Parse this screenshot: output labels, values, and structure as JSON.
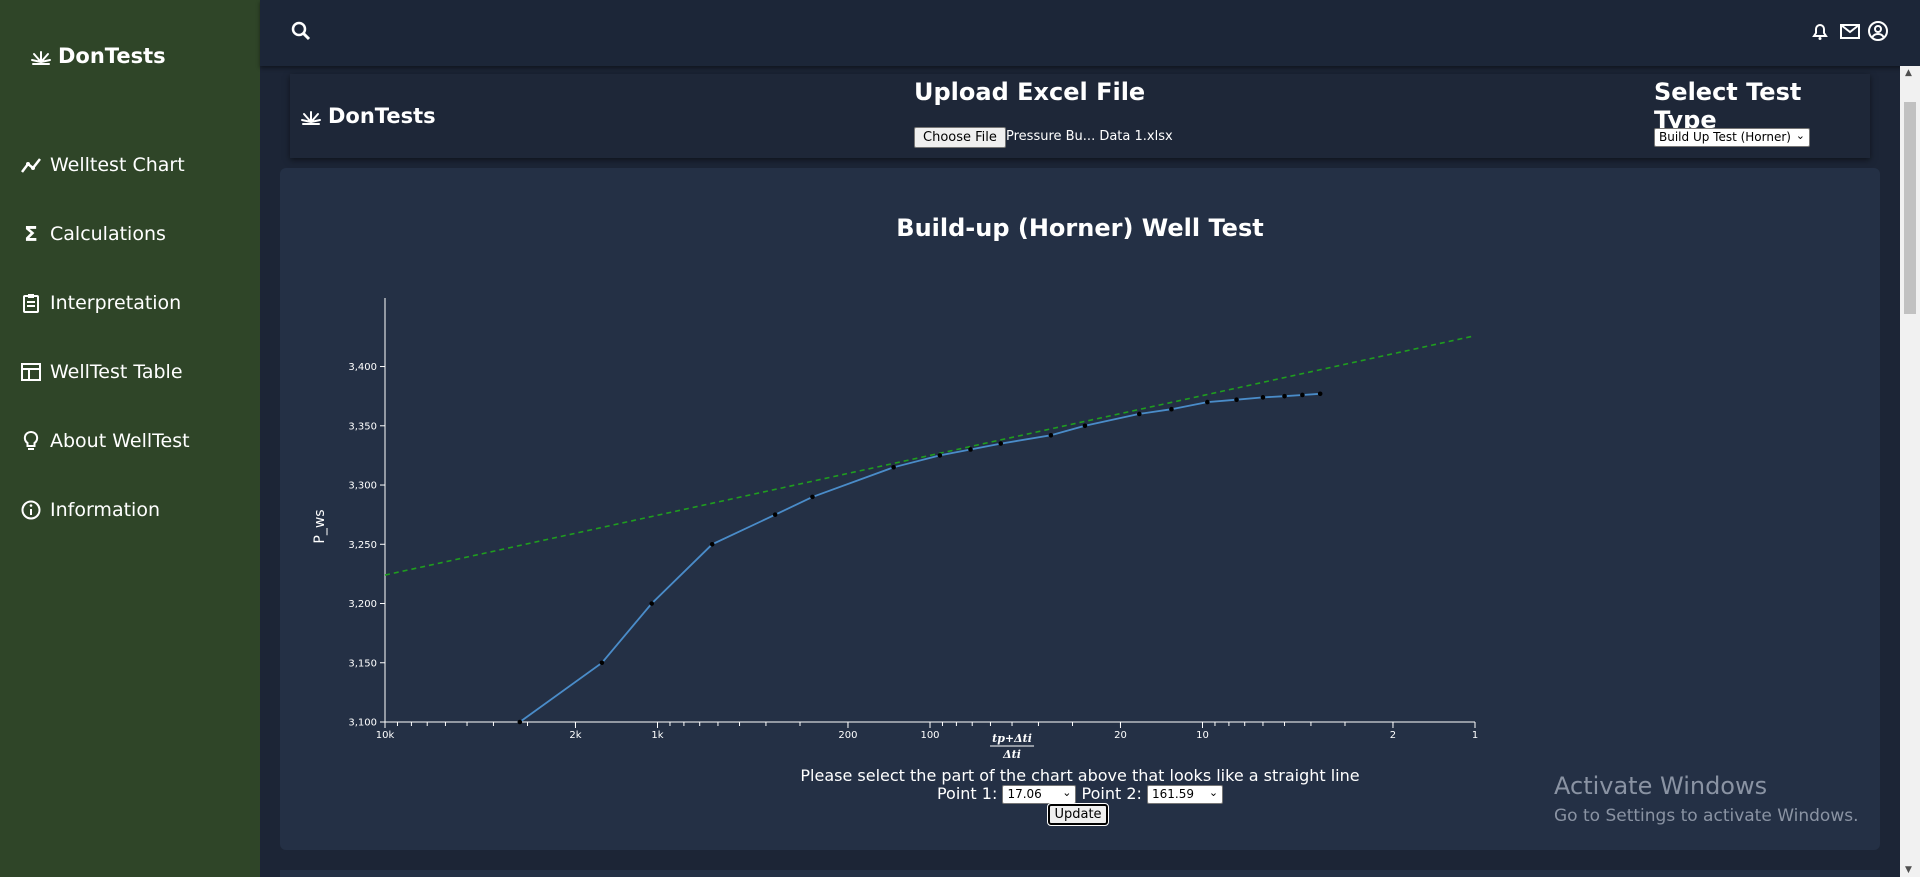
{
  "sidebar": {
    "brand": "DonTests",
    "items": [
      {
        "label": "Welltest Chart",
        "icon": "chart-line-icon"
      },
      {
        "label": "Calculations",
        "icon": "sigma-icon"
      },
      {
        "label": "Interpretation",
        "icon": "clipboard-icon"
      },
      {
        "label": "WellTest Table",
        "icon": "table-icon"
      },
      {
        "label": "About WellTest",
        "icon": "lightbulb-icon"
      },
      {
        "label": "Information",
        "icon": "info-icon"
      }
    ]
  },
  "topbar": {
    "icons": [
      "search-icon",
      "bell-icon",
      "mail-icon",
      "user-icon"
    ]
  },
  "upload": {
    "brand": "DonTests",
    "title": "Upload Excel File",
    "choose_label": "Choose File",
    "file_name": "Pressure Bu... Data 1.xlsx",
    "test_type_title": "Select Test Type",
    "test_type_value": "Build Up Test (Horner)"
  },
  "chart_data": {
    "type": "line",
    "title": "Build-up (Horner) Well Test",
    "ylabel": "P_ws",
    "xlabel": "(tp+Δt)/Δt",
    "x_scale": "log",
    "x_reversed": true,
    "xlim": [
      10000,
      1
    ],
    "ylim": [
      3100,
      3430
    ],
    "x_ticks": [
      {
        "v": 10000,
        "label": "10k"
      },
      {
        "v": 2000,
        "label": "2k"
      },
      {
        "v": 1000,
        "label": "1k"
      },
      {
        "v": 200,
        "label": "200"
      },
      {
        "v": 100,
        "label": "100"
      },
      {
        "v": 20,
        "label": "20"
      },
      {
        "v": 10,
        "label": "10"
      },
      {
        "v": 2,
        "label": "2"
      },
      {
        "v": 1,
        "label": "1"
      }
    ],
    "y_ticks": [
      {
        "v": 3100,
        "label": "3,100"
      },
      {
        "v": 3150,
        "label": "3,150"
      },
      {
        "v": 3200,
        "label": "3,200"
      },
      {
        "v": 3250,
        "label": "3,250"
      },
      {
        "v": 3300,
        "label": "3,300"
      },
      {
        "v": 3350,
        "label": "3,350"
      },
      {
        "v": 3400,
        "label": "3,400"
      }
    ],
    "series": [
      {
        "color": "#4a8cc9",
        "x": [
          3200,
          1600,
          1050,
          630,
          370,
          270,
          136,
          92,
          71,
          55,
          36,
          27,
          17.06,
          13.0,
          9.6,
          7.5,
          6.0,
          5.0,
          4.3,
          3.7
        ],
        "y": [
          3100,
          3150,
          3200,
          3250,
          3275,
          3290,
          3315,
          3325,
          3330,
          3335,
          3342,
          3350,
          3360,
          3364,
          3370,
          3372,
          3374,
          3375,
          3376,
          3377
        ]
      }
    ],
    "fit_line": {
      "color": "#1f9d1f",
      "dashed": true,
      "x": [
        10000,
        1
      ],
      "y": [
        3224,
        3426
      ]
    }
  },
  "controls": {
    "instruction": "Please select the part of the chart above that looks like a straight line",
    "point1_label": "Point 1:",
    "point1_value": "17.06",
    "point2_label": "Point 2:",
    "point2_value": "161.59",
    "update_label": "Update"
  },
  "watermark": {
    "line1": "Activate Windows",
    "line2": "Go to Settings to activate Windows."
  }
}
